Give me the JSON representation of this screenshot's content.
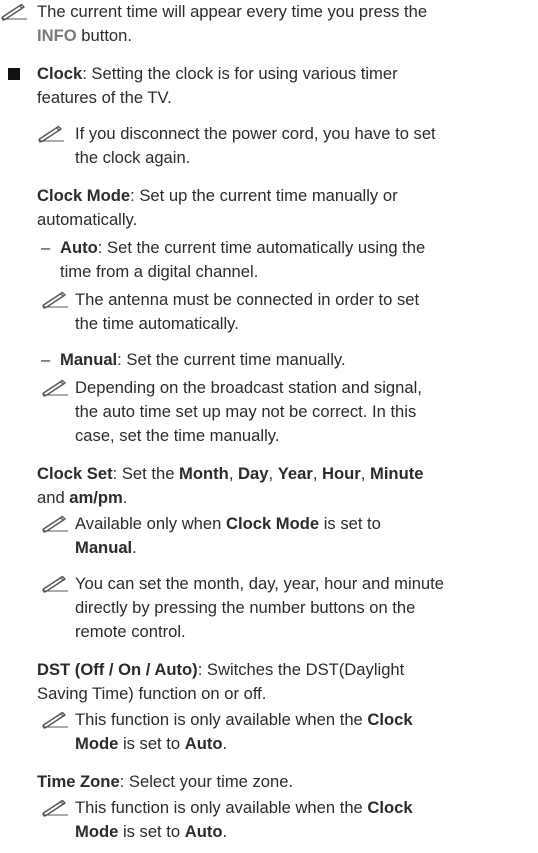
{
  "intro_note": {
    "line1": "The current time will appear every time you press the",
    "info": "INFO",
    "line2_rest": " button."
  },
  "clock": {
    "label": "Clock",
    "text_line1": ": Setting the clock is for using various timer",
    "text_line2": "features of the TV.",
    "note_line1": "If you disconnect the power cord, you have to set",
    "note_line2": "the clock again."
  },
  "clock_mode": {
    "label": "Clock Mode",
    "text_line1": ": Set up the current time manually or",
    "text_line2": "automatically.",
    "auto_label": "Auto",
    "auto_line1": ": Set the current time automatically using the",
    "auto_line2": "time from a digital channel.",
    "auto_note_line1": "The antenna must be connected in order to set",
    "auto_note_line2": "the time automatically.",
    "manual_label": "Manual",
    "manual_text": ": Set the current time manually.",
    "manual_note_line1": "Depending on the broadcast station and signal,",
    "manual_note_line2": "the auto time set up may not be correct. In this",
    "manual_note_line3": "case, set the time manually."
  },
  "clock_set": {
    "label": "Clock Set",
    "text_a": ": Set the ",
    "month": "Month",
    "comma1": ", ",
    "day": "Day",
    "comma2": ", ",
    "year": "Year",
    "comma3": ", ",
    "hour": "Hour",
    "comma4": ", ",
    "minute": "Minute",
    "and": "and ",
    "ampm": "am/pm",
    "period": ".",
    "note1_a": "Available only when ",
    "note1_b": "Clock Mode",
    "note1_c": " is set to",
    "note1_d": "Manual",
    "note1_e": ".",
    "note2_line1": "You can set the month, day, year, hour and minute",
    "note2_line2": "directly by pressing the number buttons on the",
    "note2_line3": "remote control."
  },
  "dst": {
    "label": "DST (Off / On / Auto)",
    "text_line1": ": Switches the DST(Daylight",
    "text_line2": "Saving Time) function on or off.",
    "note_a": "This function is only available when the ",
    "note_b": "Clock",
    "note_c": "Mode",
    "note_d": " is set to ",
    "note_e": "Auto",
    "note_f": "."
  },
  "time_zone": {
    "label": "Time Zone",
    "text": ": Select your time zone.",
    "note_a": "This function is only available when the ",
    "note_b": "Clock",
    "note_c": "Mode",
    "note_d": " is set to ",
    "note_e": "Auto",
    "note_f": "."
  },
  "dash_char": "–",
  "icon_name": "note-pencil-icon"
}
